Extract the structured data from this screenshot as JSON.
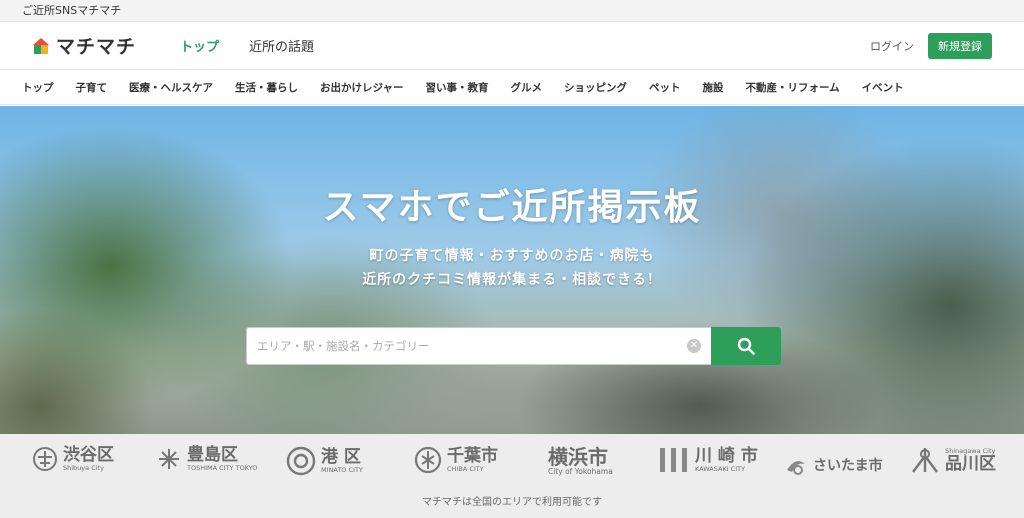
{
  "top_strip": {
    "text": "ご近所SNSマチマチ"
  },
  "header": {
    "logo_text": "マチマチ",
    "nav": [
      {
        "label": "トップ"
      },
      {
        "label": "近所の話題"
      }
    ],
    "login_label": "ログイン",
    "signup_label": "新規登録",
    "accent_color": "#2e9e5b"
  },
  "categories": [
    "トップ",
    "子育て",
    "医療・ヘルスケア",
    "生活・暮らし",
    "お出かけレジャー",
    "習い事・教育",
    "グルメ",
    "ショッピング",
    "ペット",
    "施設",
    "不動産・リフォーム",
    "イベント"
  ],
  "hero": {
    "title": "スマホでご近所掲示板",
    "sub_line1": "町の子育て情報・おすすめのお店・病院も",
    "sub_line2": "近所のクチコミ情報が集まる・相談できる！",
    "search_placeholder": "エリア・駅・施設名・カテゴリー",
    "search_icon": "search-icon",
    "clear_icon": "clear-icon"
  },
  "cities": [
    {
      "name": "渋谷区",
      "sub": "Shibuya City"
    },
    {
      "name": "豊島区",
      "sub": "TOSHIMA CITY TOKYO"
    },
    {
      "name": "港 区",
      "sub": "MINATO CITY"
    },
    {
      "name": "千葉市",
      "sub": "CHIBA CITY"
    },
    {
      "name": "横浜市",
      "sub": "City of Yokohama"
    },
    {
      "name": "川 崎 市",
      "sub": "KAWASAKI CITY"
    },
    {
      "name": "さいたま市",
      "sub": ""
    },
    {
      "name": "品川区",
      "sub": "Shinagawa City"
    }
  ],
  "cities_note": "マチマチは全国のエリアで利用可能です"
}
